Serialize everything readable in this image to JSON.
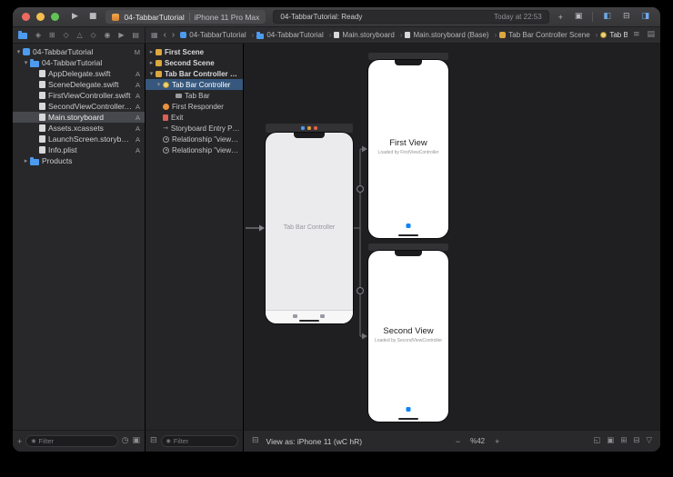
{
  "titlebar": {
    "scheme_name": "04-TabbarTutorial",
    "device": "iPhone 11 Pro Max",
    "status_primary": "04-TabbarTutorial: Ready",
    "status_secondary": "Today at 22:53"
  },
  "jumpbar": {
    "items": [
      {
        "label": "04-TabbarTutorial"
      },
      {
        "label": "04-TabbarTutorial"
      },
      {
        "label": "Main.storyboard"
      },
      {
        "label": "Main.storyboard (Base)"
      },
      {
        "label": "Tab Bar Controller Scene"
      },
      {
        "label": "Tab Bar Controller"
      }
    ]
  },
  "navigator": {
    "rows": [
      {
        "disc": "▾",
        "label": "04-TabbarTutorial",
        "badge": "M"
      },
      {
        "disc": "▾",
        "label": "04-TabbarTutorial",
        "badge": ""
      },
      {
        "disc": "",
        "label": "AppDelegate.swift",
        "badge": "A"
      },
      {
        "disc": "",
        "label": "SceneDelegate.swift",
        "badge": "A"
      },
      {
        "disc": "",
        "label": "FirstViewController.swift",
        "badge": "A"
      },
      {
        "disc": "",
        "label": "SecondViewController.swift",
        "badge": "A"
      },
      {
        "disc": "",
        "label": "Main.storyboard",
        "badge": "A"
      },
      {
        "disc": "",
        "label": "Assets.xcassets",
        "badge": "A"
      },
      {
        "disc": "",
        "label": "LaunchScreen.storyboard",
        "badge": "A"
      },
      {
        "disc": "",
        "label": "Info.plist",
        "badge": "A"
      },
      {
        "disc": "▸",
        "label": "Products",
        "badge": ""
      }
    ],
    "filter_placeholder": "Filter"
  },
  "outline": {
    "rows": [
      {
        "disc": "▸",
        "label": "First Scene"
      },
      {
        "disc": "▸",
        "label": "Second Scene"
      },
      {
        "disc": "▾",
        "label": "Tab Bar Controller Scene"
      },
      {
        "disc": "▾",
        "label": "Tab Bar Controller"
      },
      {
        "disc": "",
        "label": "Tab Bar"
      },
      {
        "disc": "",
        "label": "First Responder"
      },
      {
        "disc": "",
        "label": "Exit"
      },
      {
        "disc": "",
        "label": "Storyboard Entry Point"
      },
      {
        "disc": "",
        "label": "Relationship \"view contr…"
      },
      {
        "disc": "",
        "label": "Relationship \"view contr…"
      }
    ],
    "filter_placeholder": "Filter"
  },
  "canvas": {
    "tab_bar_controller": {
      "label": "Tab Bar Controller"
    },
    "first_view": {
      "title": "First View",
      "subtitle": "Loaded by FirstViewController"
    },
    "second_view": {
      "title": "Second View",
      "subtitle": "Loaded by SecondViewController"
    }
  },
  "statusbar": {
    "view_as": "View as: iPhone 11 (wC hR)",
    "zoom_level": "%42"
  },
  "glyphs": {
    "play": "▶",
    "stop": "■",
    "plus": "+",
    "minus": "−",
    "back": "‹",
    "forward": "›",
    "related_items": "▦",
    "nav_source_control": "◈",
    "nav_symbols": "⊞",
    "nav_issues": "△",
    "nav_tests": "◇",
    "nav_debug": "◉",
    "nav_breakpoints": "▶",
    "nav_reports": "▤",
    "toggle_navigator": "◧",
    "toggle_debug": "⊟",
    "toggle_inspector": "◨",
    "versions_editor": "▣",
    "editor_options": "≡",
    "editor_layout": "▤",
    "filter": "◉",
    "recents": "◷",
    "flagged": "▣",
    "outline_toggle": "⊟",
    "entry_arrow": "→",
    "constraints": [
      "◱",
      "▣",
      "⊞",
      "⊟",
      "▽"
    ]
  },
  "colors": {
    "accent_blue": "#4d9bf0",
    "tab_item_blue": "#0a84ff",
    "dock_dots": [
      "#4d9bf0",
      "#e09a3e",
      "#dd5f4f"
    ],
    "selection_outline": "#36577e"
  }
}
